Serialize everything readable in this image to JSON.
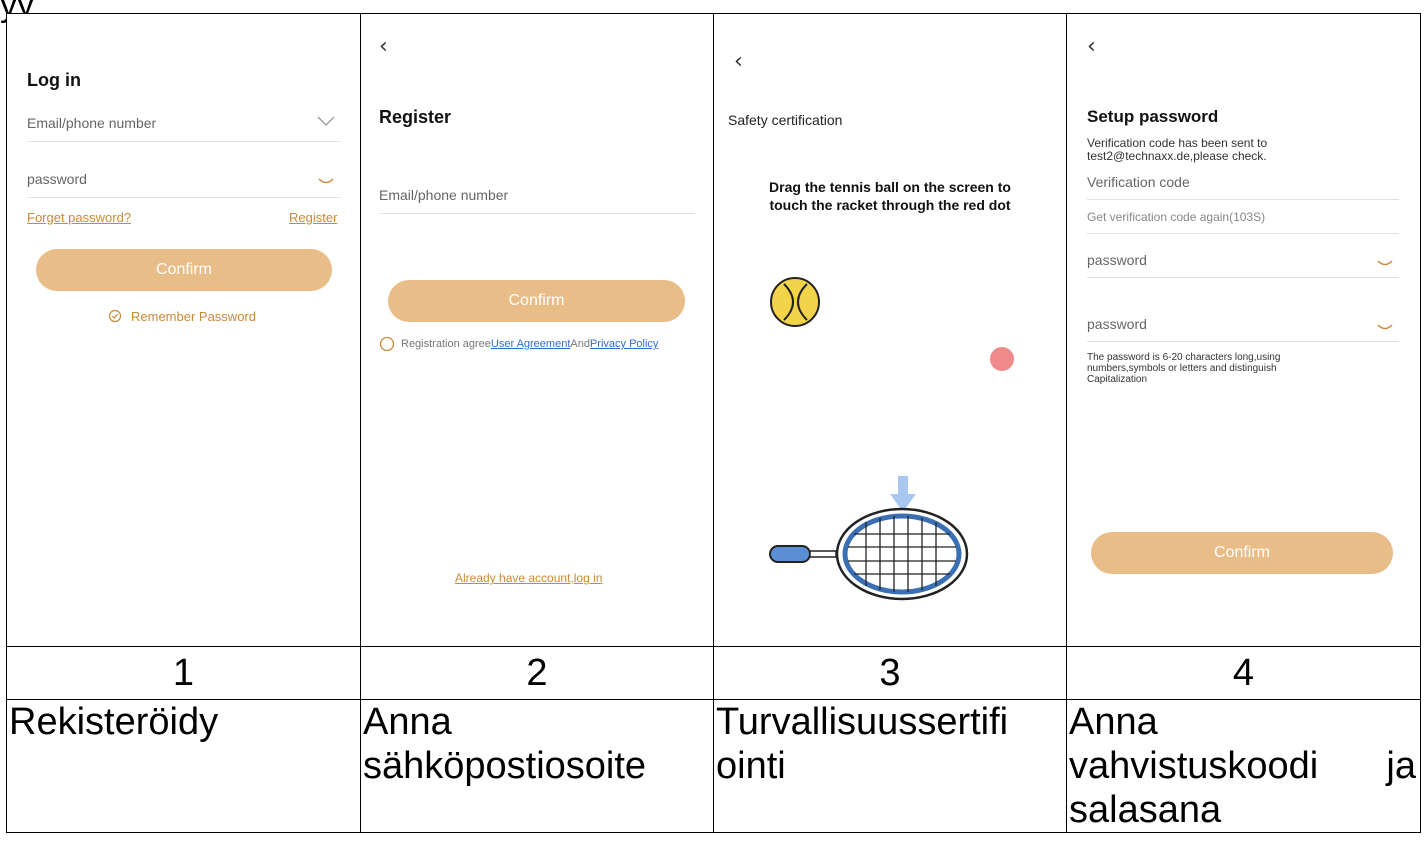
{
  "top_clip": "yy",
  "steps": [
    {
      "number": "1",
      "caption_lines": [
        "Rekisteröidy"
      ]
    },
    {
      "number": "2",
      "caption_lines": [
        "Anna",
        "sähköpostiosoite"
      ]
    },
    {
      "number": "3",
      "caption_lines": [
        "Turvallisuussertifi",
        "ointi"
      ]
    },
    {
      "number": "4",
      "caption_lines": [
        "Anna",
        "vahvistuskoodi ja",
        "salasana"
      ]
    }
  ],
  "login": {
    "title": "Log in",
    "email_placeholder": "Email/phone number",
    "password_placeholder": "password",
    "forget": "Forget password?",
    "register": "Register",
    "confirm": "Confirm",
    "remember": "Remember Password"
  },
  "register": {
    "back": "‹",
    "title": "Register",
    "email_placeholder": "Email/phone number",
    "confirm": "Confirm",
    "agree_prefix": "Registration agree",
    "user_agreement": "User Agreement",
    "and": "And",
    "privacy": "Privacy Policy",
    "login_link": "Already have account,log in"
  },
  "safety": {
    "back": "‹",
    "title": "Safety certification",
    "instruction_line1": "Drag the tennis ball on the screen to",
    "instruction_line2": "touch the racket through the red dot"
  },
  "setup": {
    "back": "‹",
    "title": "Setup password",
    "sent_line1": "Verification code has been sent to",
    "sent_line2": "test2@technaxx.de,please check.",
    "code_placeholder": "Verification code",
    "resend": "Get verification code again(103S)",
    "password1_placeholder": "password",
    "password2_placeholder": "password",
    "rule_line1": "The password is 6-20 characters long,using",
    "rule_line2": "numbers,symbols or letters and distinguish",
    "rule_line3": "Capitalization",
    "confirm": "Confirm"
  },
  "colors": {
    "accent": "#e9bd88",
    "link": "#c98a3a",
    "blue_link": "#2f6fd0",
    "ball": "#f3d34a",
    "dot": "#ef8a8a",
    "racket": "#3b6fb3"
  }
}
